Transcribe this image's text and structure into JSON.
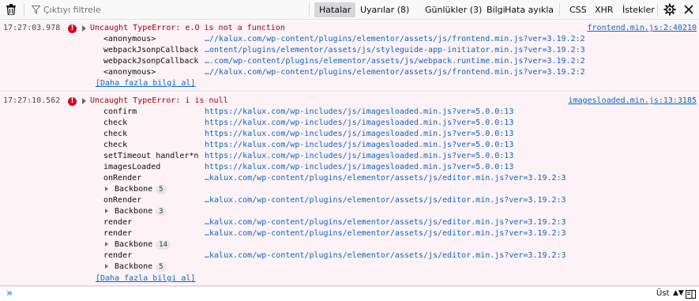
{
  "toolbar": {
    "filter_placeholder": "Çıktıyı filtrele",
    "tabs": [
      "Hatalar",
      "Uyarılar (8)",
      "Günlükler (3)",
      "Bilgi",
      "Hata ayıkla"
    ],
    "categories": [
      "CSS",
      "XHR",
      "İstekler"
    ]
  },
  "messages": [
    {
      "timestamp": "17:27:03.978",
      "text": "Uncaught TypeError: e.O is not a function",
      "source": "frontend.min.js:2:40210",
      "stack": [
        {
          "fn": "<anonymous>",
          "url": "…//kalux.com/wp-content/plugins/elementor/assets/js/frontend.min.js?ver=3.19.2:2"
        },
        {
          "fn": "webpackJsonpCallback",
          "url": "…ontent/plugins/elementor/assets/js/styleguide-app-initiator.min.js?ver=3.19.2:3"
        },
        {
          "fn": "webpackJsonpCallback",
          "url": "….com/wp-content/plugins/elementor/assets/js/webpack.runtime.min.js?ver=3.19.2:2"
        },
        {
          "fn": "<anonymous>",
          "url": "…//kalux.com/wp-content/plugins/elementor/assets/js/frontend.min.js?ver=3.19.2:2"
        }
      ],
      "more": "[Daha fazla bilgi al]"
    },
    {
      "timestamp": "17:27:10.562",
      "text": "Uncaught TypeError: i is null",
      "source": "imagesloaded.min.js:13:3185",
      "stack": [
        {
          "fn": "confirm",
          "url": "https://kalux.com/wp-includes/js/imagesloaded.min.js?ver=5.0.0:13"
        },
        {
          "fn": "check",
          "url": "https://kalux.com/wp-includes/js/imagesloaded.min.js?ver=5.0.0:13"
        },
        {
          "fn": "check",
          "url": "https://kalux.com/wp-includes/js/imagesloaded.min.js?ver=5.0.0:13"
        },
        {
          "fn": "check",
          "url": "https://kalux.com/wp-includes/js/imagesloaded.min.js?ver=5.0.0:13"
        },
        {
          "fn": "setTimeout handler*n",
          "url": "https://kalux.com/wp-includes/js/imagesloaded.min.js?ver=5.0.0:13"
        },
        {
          "fn": "imagesLoaded",
          "url": "https://kalux.com/wp-includes/js/imagesloaded.min.js?ver=5.0.0:13"
        },
        {
          "fn": "onRender",
          "url": "…kalux.com/wp-content/plugins/elementor/assets/js/editor.min.js?ver=3.19.2:3"
        },
        {
          "group": "Backbone",
          "count": "5"
        },
        {
          "fn": "onRender",
          "url": "…kalux.com/wp-content/plugins/elementor/assets/js/editor.min.js?ver=3.19.2:3"
        },
        {
          "group": "Backbone",
          "count": "3"
        },
        {
          "fn": "render",
          "url": "…kalux.com/wp-content/plugins/elementor/assets/js/editor.min.js?ver=3.19.2:3"
        },
        {
          "fn": "render",
          "url": "…kalux.com/wp-content/plugins/elementor/assets/js/editor.min.js?ver=3.19.2:3"
        },
        {
          "group": "Backbone",
          "count": "14"
        },
        {
          "fn": "render",
          "url": "…kalux.com/wp-content/plugins/elementor/assets/js/editor.min.js?ver=3.19.2:3"
        },
        {
          "group": "Backbone",
          "count": "5"
        }
      ],
      "more": "[Daha fazla bilgi al]"
    }
  ],
  "bottom": {
    "prompt": "»",
    "position_label": "Üst"
  }
}
